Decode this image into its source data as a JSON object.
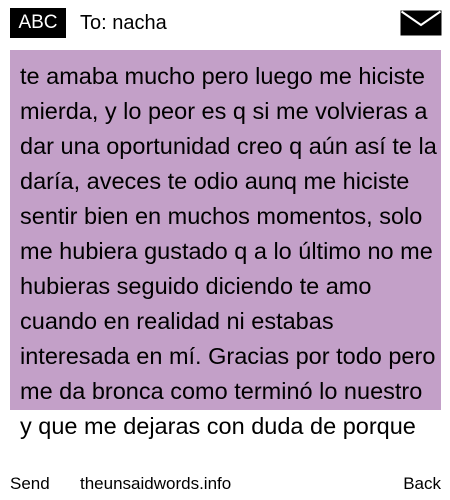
{
  "header": {
    "input_mode": "ABC",
    "recipient": "To: nacha",
    "envelope_icon": "envelope-icon"
  },
  "message": {
    "background_color": "#c3a0c8",
    "body": "te amaba mucho pero luego me hiciste mierda, y lo peor es q si me volvieras a dar una oportunidad creo q aún así te la daría, aveces te odio aunq me hiciste sentir bien en muchos momentos, solo me hubiera gustado q a lo último no me hubieras seguido diciendo te amo cuando en realidad ni estabas interesada en mí. Gracias por todo pero me da bronca como terminó lo nuestro y que me dejaras con duda de porque"
  },
  "softkeys": {
    "left": "Send",
    "center": "theunsaidwords.info",
    "right": "Back"
  }
}
